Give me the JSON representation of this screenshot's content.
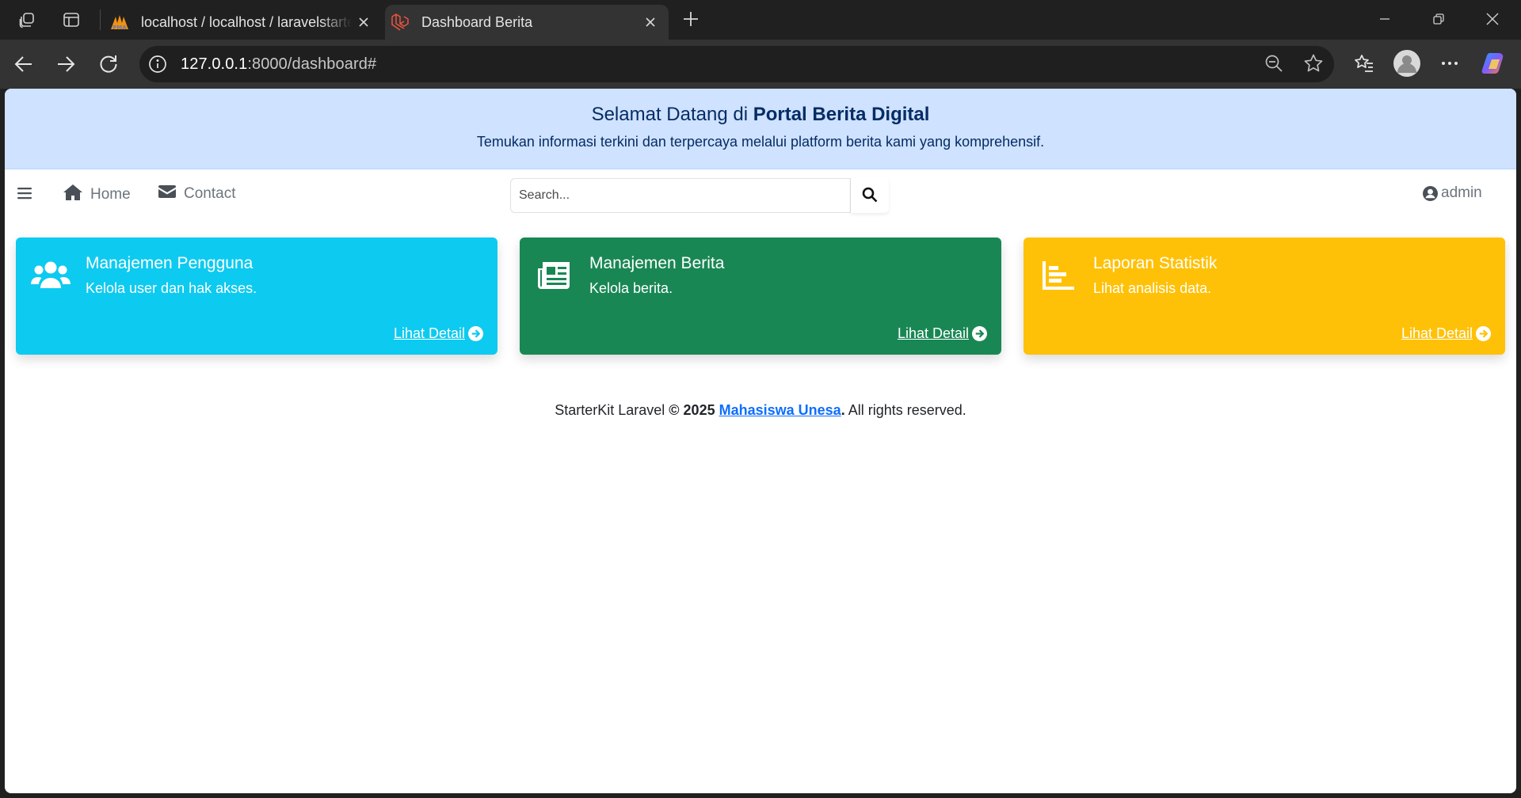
{
  "browser": {
    "tabs": [
      {
        "title": "localhost / localhost / laravelstarterkit",
        "active": false
      },
      {
        "title": "Dashboard Berita",
        "active": true
      }
    ],
    "url": {
      "host": "127.0.0.1",
      "rest": ":8000/dashboard#"
    }
  },
  "banner": {
    "title_prefix": "Selamat Datang di ",
    "title_emphasis": "Portal Berita Digital",
    "subtitle": "Temukan informasi terkini dan terpercaya melalui platform berita kami yang komprehensif."
  },
  "navbar": {
    "menu_icon": "bars-icon",
    "links": [
      {
        "label": "Home",
        "icon": "home-icon"
      },
      {
        "label": "Contact",
        "icon": "envelope-icon"
      }
    ],
    "search": {
      "placeholder": "Search...",
      "value": ""
    },
    "user": {
      "label": "admin",
      "icon": "user-circle-icon"
    }
  },
  "cards": [
    {
      "title": "Manajemen Pengguna",
      "subtitle": "Kelola user dan hak akses.",
      "link": "Lihat Detail",
      "icon": "users-icon",
      "color": "#0dcaf0"
    },
    {
      "title": "Manajemen Berita",
      "subtitle": "Kelola berita.",
      "link": "Lihat Detail",
      "icon": "newspaper-icon",
      "color": "#198754"
    },
    {
      "title": "Laporan Statistik",
      "subtitle": "Lihat analisis data.",
      "link": "Lihat Detail",
      "icon": "chart-bar-icon",
      "color": "#ffc107"
    }
  ],
  "footer": {
    "prefix": "StarterKit Laravel ",
    "copyright": "© 2025",
    "author": "Mahasiswa Unesa",
    "suffix": ". All rights reserved."
  },
  "colors": {
    "banner_bg": "#cfe2ff",
    "banner_text": "#052c65",
    "link": "#0d6efd"
  }
}
